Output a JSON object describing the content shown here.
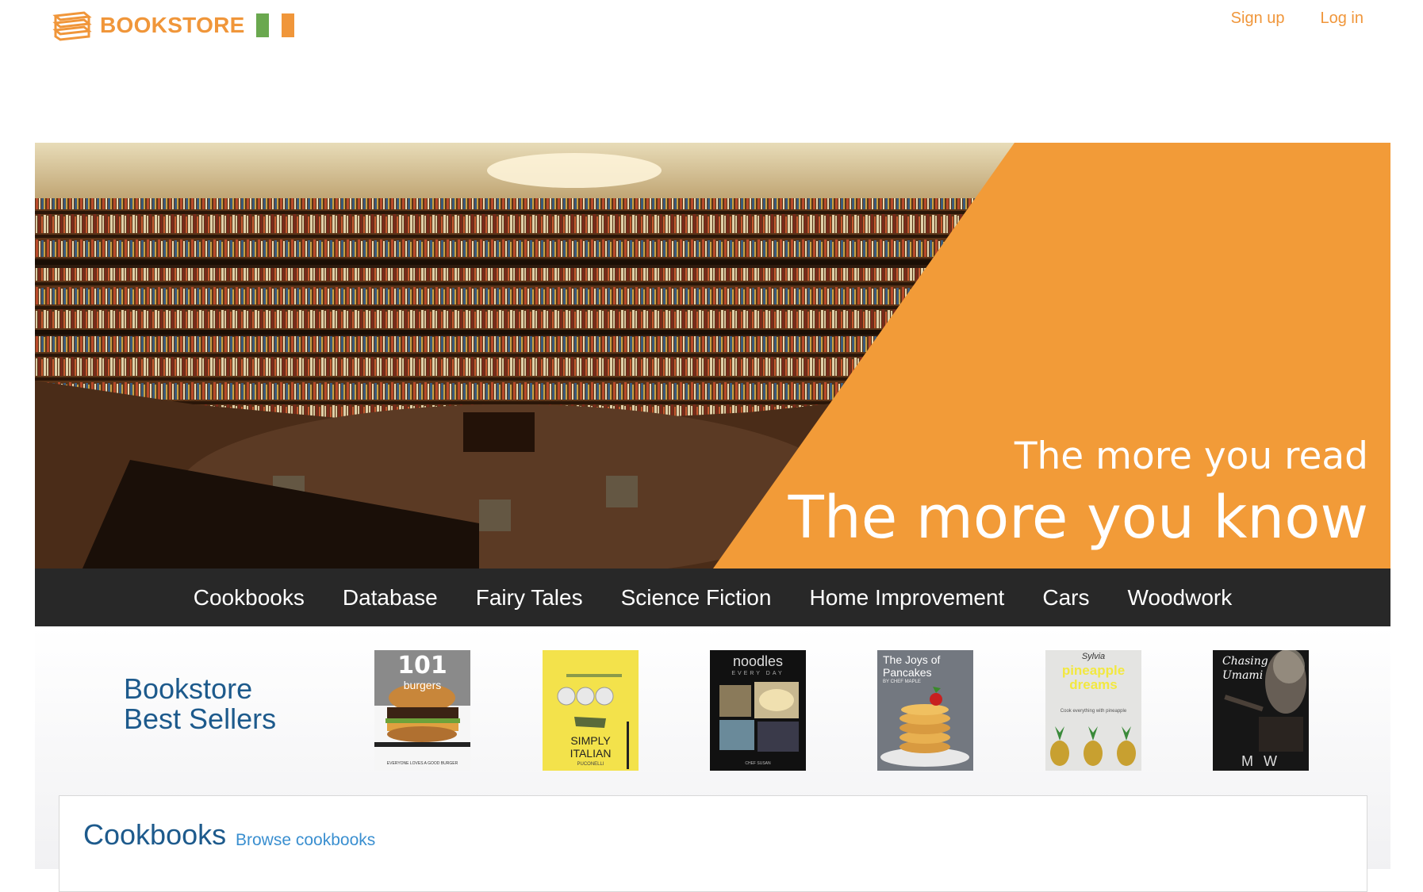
{
  "header": {
    "logo_text": "BOOKSTORE",
    "flag_colors": [
      "#6aa84f",
      "#ffffff",
      "#f0963a"
    ],
    "signup_label": "Sign up",
    "login_label": "Log in"
  },
  "hero": {
    "line1": "The more you read",
    "line2": "The more you know",
    "accent_color": "#f29b38"
  },
  "categories": [
    "Cookbooks",
    "Database",
    "Fairy Tales",
    "Science Fiction",
    "Home Improvement",
    "Cars",
    "Woodwork"
  ],
  "best_sellers": {
    "title_line1": "Bookstore",
    "title_line2": "Best Sellers",
    "books": [
      {
        "title": "101",
        "subtitle": "burgers",
        "tagline": "EVERYONE LOVES A GOOD BURGER"
      },
      {
        "title": "SIMPLY",
        "subtitle": "ITALIAN",
        "author": "PUCONELLI"
      },
      {
        "title": "noodles",
        "subtitle": "EVERY DAY",
        "author": "CHEF SUSAN"
      },
      {
        "title": "The Joys of",
        "subtitle": "Pancakes",
        "author": "BY CHEF MAPLE"
      },
      {
        "author": "Sylvia",
        "title": "pineapple",
        "subtitle": "dreams",
        "tagline": "Cook everything with pineapple"
      },
      {
        "title": "Chasing",
        "subtitle": "Umami",
        "author": "M W"
      }
    ]
  },
  "cookbooks_section": {
    "title": "Cookbooks",
    "browse_link": "Browse cookbooks"
  }
}
